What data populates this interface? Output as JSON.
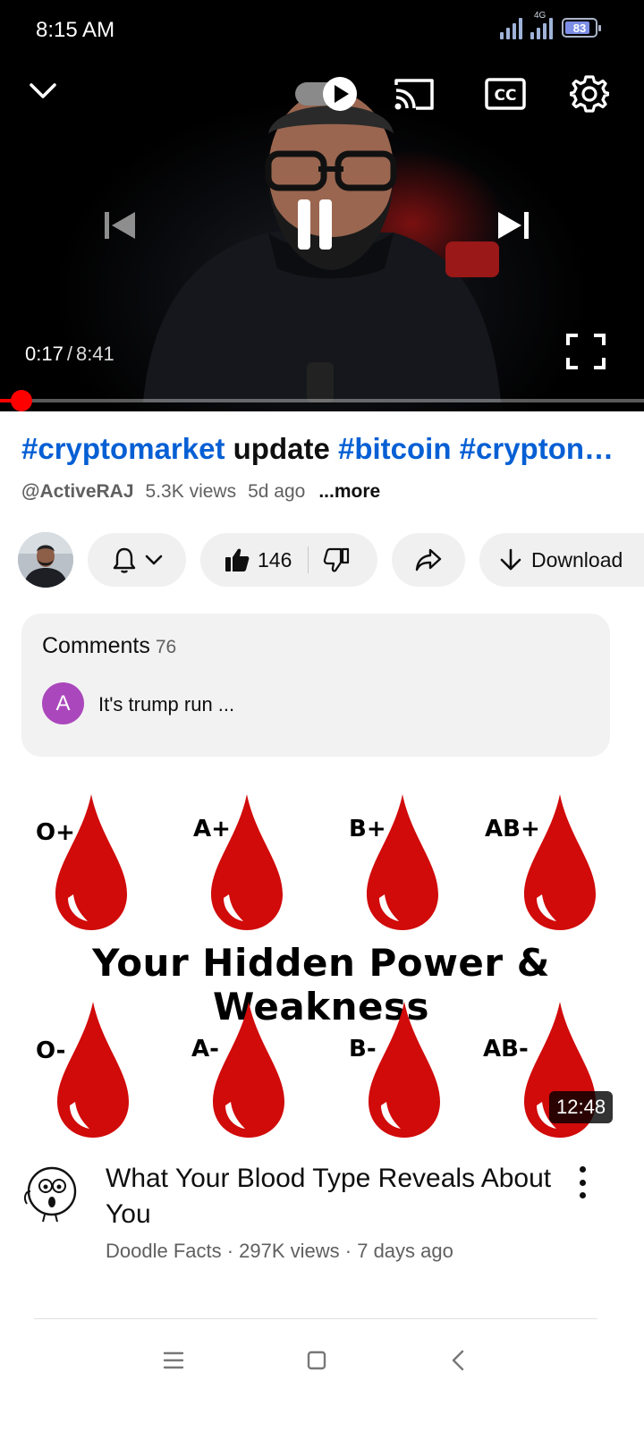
{
  "status_bar": {
    "time": "8:15 AM",
    "network": "4G",
    "battery": "83",
    "battery_level": 0.83
  },
  "player": {
    "current_time": "0:17",
    "separator": "/",
    "duration": "8:41",
    "progress": 0.033,
    "icons": [
      "chevron-down-icon",
      "autoplay-toggle-icon",
      "cast-icon",
      "captions-icon",
      "settings-icon",
      "previous-icon",
      "pause-icon",
      "next-icon",
      "fullscreen-icon"
    ],
    "accent_color": "#ff0000"
  },
  "video": {
    "title_parts": {
      "tag1": "#cryptomarket",
      "word": "update",
      "tag2": "#bitcoin",
      "tag3": "#crypton…"
    },
    "channel": "@ActiveRAJ",
    "views": "5.3K views",
    "age": "5d ago",
    "more": "...more"
  },
  "actions": {
    "likes": "146",
    "download": "Download"
  },
  "comments": {
    "label": "Comments",
    "count": "76",
    "avatar_letter": "A",
    "top_comment": "It's trump run  ..."
  },
  "recommended": {
    "thumbnail": {
      "caption": "Your Hidden Power & Weakness",
      "blood_types_top": [
        "O+",
        "A+",
        "B+",
        "AB+"
      ],
      "blood_types_bottom": [
        "O-",
        "A-",
        "B-",
        "AB-"
      ]
    },
    "duration": "12:48",
    "title": "What Your Blood Type Reveals About You",
    "meta": "Doodle Facts · 297K views · 7 days ago"
  },
  "system_nav": {
    "icons": [
      "menu-icon",
      "home-icon",
      "back-icon"
    ]
  }
}
